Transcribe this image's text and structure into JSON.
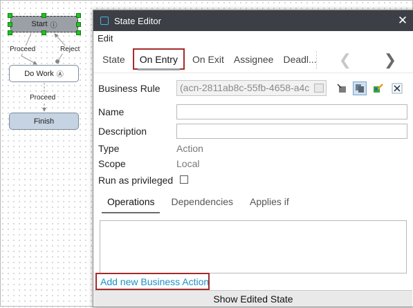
{
  "workflow": {
    "nodes": {
      "start": {
        "label": "Start",
        "icon": "info-circle-icon"
      },
      "do_work": {
        "label": "Do Work",
        "icon": "action-circle-icon"
      },
      "finish": {
        "label": "Finish"
      }
    },
    "edges": {
      "proceed_1": "Proceed",
      "reject": "Reject",
      "proceed_2": "Proceed"
    }
  },
  "dialog": {
    "title": "State Editor",
    "close_glyph": "✕",
    "menu": {
      "edit": "Edit"
    },
    "tabs": [
      "State",
      "On Entry",
      "On Exit",
      "Assignee",
      "Deadl..."
    ],
    "active_tab": "On Entry",
    "nav": {
      "prev": "❮",
      "next": "❯"
    },
    "fields": {
      "business_rule": {
        "label": "Business Rule",
        "value": "(acn-2811ab8c-55fb-4658-a4c"
      },
      "name": {
        "label": "Name",
        "value": ""
      },
      "description": {
        "label": "Description",
        "value": ""
      },
      "type": {
        "label": "Type",
        "value": "Action"
      },
      "scope": {
        "label": "Scope",
        "value": "Local"
      },
      "run_as_privileged": {
        "label": "Run as privileged",
        "checked": false
      }
    },
    "toolbar_icons": [
      "select-rule-icon",
      "copy-rule-icon",
      "edit-rule-icon",
      "clear-rule-icon"
    ],
    "subtabs": [
      "Operations",
      "Dependencies",
      "Applies if"
    ],
    "active_subtab": "Operations",
    "add_action_link": "Add new Business Action",
    "footer_button": "Show Edited State"
  },
  "colors": {
    "titlebar": "#3c3f45",
    "highlight": "#a52a2a",
    "link": "#1d8fc6",
    "selection_handle": "#22c322"
  }
}
